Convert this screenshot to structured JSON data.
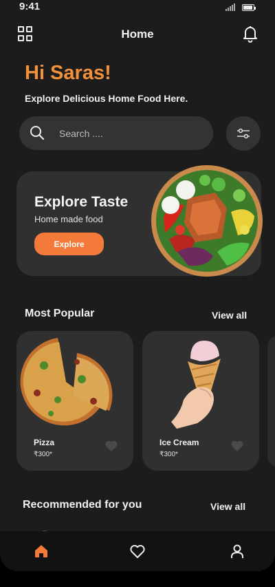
{
  "status": {
    "time": "9:41",
    "battery_level": 0.95
  },
  "header": {
    "title": "Home"
  },
  "greeting": "Hi Saras!",
  "subtitle": "Explore Delicious Home Food Here.",
  "search": {
    "placeholder": "Search ...."
  },
  "promo": {
    "title": "Explore Taste",
    "subtitle": "Home made food",
    "button_label": "Explore"
  },
  "most_popular": {
    "title": "Most Popular",
    "view_all": "View all",
    "items": [
      {
        "name": "Pizza",
        "price": "₹300*",
        "image_icon": "pizza-image"
      },
      {
        "name": "Ice Cream",
        "price": "₹300*",
        "image_icon": "ice-cream-image"
      }
    ]
  },
  "recommended": {
    "title": "Recommended for you",
    "view_all": "View all"
  },
  "colors": {
    "accent": "#f47a3a",
    "greeting": "#f2913a",
    "background": "#1c1c1c",
    "card": "#303030"
  },
  "nav": {
    "items": [
      {
        "icon": "home-icon",
        "active": true
      },
      {
        "icon": "heart-icon",
        "active": false
      },
      {
        "icon": "profile-icon",
        "active": false
      }
    ]
  }
}
